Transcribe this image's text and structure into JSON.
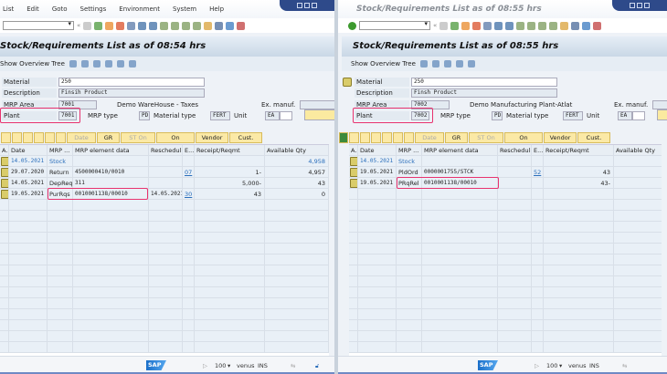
{
  "menu": [
    "List",
    "Edit",
    "Goto",
    "Settings",
    "Environment",
    "System",
    "Help"
  ],
  "colors": {
    "highlight": "#e8336f",
    "title_bg": "#c9d8e6",
    "button_bg": "#fbe9a6",
    "link": "#2a6ebb"
  },
  "panes": [
    {
      "window_title": "",
      "title": "Stock/Requirements List as of 08:54 hrs",
      "show_overview_tree": "Show Overview Tree",
      "fields": {
        "material_label": "Material",
        "material": "250",
        "description_label": "Description",
        "description": "Finsih Product",
        "mrp_area_label": "MRP Area",
        "mrp_area": "7001",
        "mrp_area_desc": "Demo WareHouse - Taxes",
        "ex_manuf_label": "Ex. manuf.",
        "plant_label": "Plant",
        "plant": "7001",
        "mrp_type_label": "MRP type",
        "mrp_type": "PD",
        "material_type_label": "Material type",
        "material_type": "FERT",
        "unit_label": "Unit",
        "unit": "EA"
      },
      "buttons": [
        "Date",
        "GR",
        "ST On",
        "On",
        "Vendor",
        "Cust."
      ],
      "columns": [
        "A..",
        "Date",
        "MRP ...",
        "MRP element data",
        "Rescheduli...",
        "E...",
        "Receipt/Reqmt",
        "Available Qty"
      ],
      "rows": [
        {
          "date": "14.05.2021",
          "mrp": "Stock",
          "element": "",
          "resched": "",
          "e": "",
          "receipt": "",
          "available": "4,958"
        },
        {
          "date": "29.07.2020",
          "mrp": "Return",
          "element": "4500000410/0010",
          "resched": "",
          "e": "07",
          "receipt": "1-",
          "available": "4,957"
        },
        {
          "date": "14.05.2021",
          "mrp": "DepReq",
          "element": "311",
          "resched": "",
          "e": "",
          "receipt": "5,000-",
          "available": "43"
        },
        {
          "date": "19.05.2021",
          "mrp": "PurRqs",
          "element": "0010001138/00010",
          "resched": "14.05.2021",
          "e": "30",
          "receipt": "43",
          "available": "0"
        }
      ],
      "status": {
        "zoom": "100",
        "server": "venus",
        "mode": "INS"
      }
    },
    {
      "window_title": "Stock/Requirements List as of 08:55 hrs",
      "title": "Stock/Requirements List as of 08:55 hrs",
      "show_overview_tree": "Show Overview Tree",
      "fields": {
        "material_label": "Material",
        "material": "250",
        "description_label": "Description",
        "description": "Finsh Product",
        "mrp_area_label": "MRP Area",
        "mrp_area": "7002",
        "mrp_area_desc": "Demo Manufacturing Plant-Atlat",
        "ex_manuf_label": "Ex. manuf.",
        "plant_label": "Plant",
        "plant": "7002",
        "mrp_type_label": "MRP type",
        "mrp_type": "PD",
        "material_type_label": "Material type",
        "material_type": "FERT",
        "unit_label": "Unit",
        "unit": "EA"
      },
      "buttons": [
        "Date",
        "GR",
        "ST On",
        "On",
        "Vendor",
        "Cust."
      ],
      "columns": [
        "A..",
        "Date",
        "MRP ...",
        "MRP element data",
        "Rescheduli...",
        "E...",
        "Receipt/Reqmt",
        "Available Qty"
      ],
      "rows": [
        {
          "date": "14.05.2021",
          "mrp": "Stock",
          "element": "",
          "resched": "",
          "e": "",
          "receipt": "",
          "available": ""
        },
        {
          "date": "19.05.2021",
          "mrp": "PldOrd",
          "element": "0000001755/STCK",
          "resched": "",
          "e": "52",
          "receipt": "43",
          "available": ""
        },
        {
          "date": "19.05.2021",
          "mrp": "PRqRel",
          "element": "0010001138/00010",
          "resched": "",
          "e": "",
          "receipt": "43-",
          "available": ""
        }
      ],
      "status": {
        "zoom": "100",
        "server": "venus",
        "mode": "INS"
      }
    }
  ]
}
